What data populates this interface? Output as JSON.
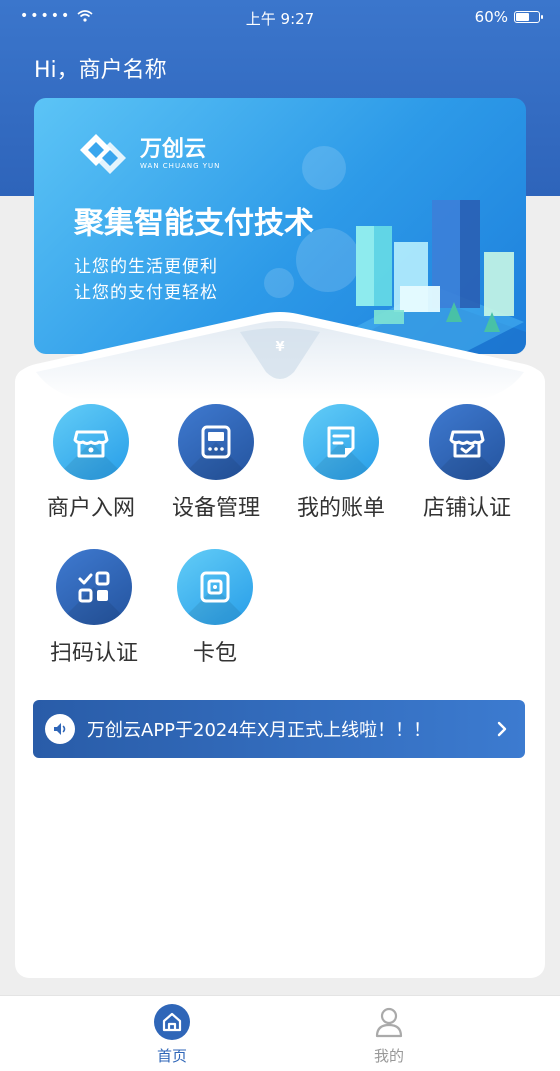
{
  "status_bar": {
    "time": "上午 9:27",
    "battery": "60%",
    "battery_level": 0.6
  },
  "header": {
    "greeting": "Hi，商户名称"
  },
  "banner": {
    "logo_cn": "万创云",
    "logo_en": "WAN CHUANG YUN",
    "title": "聚集智能支付技术",
    "subtitle_1": "让您的生活更便利",
    "subtitle_2": "让您的支付更轻松",
    "currency_symbol": "¥"
  },
  "menu": [
    {
      "label": "商户入网",
      "icon": "store-icon"
    },
    {
      "label": "设备管理",
      "icon": "pos-device-icon"
    },
    {
      "label": "我的账单",
      "icon": "bill-icon"
    },
    {
      "label": "店铺认证",
      "icon": "store-verify-icon"
    },
    {
      "label": "扫码认证",
      "icon": "qr-scan-icon"
    },
    {
      "label": "卡包",
      "icon": "card-wallet-icon"
    }
  ],
  "notice": {
    "text": "万创云APP于2024年X月正式上线啦！！！",
    "icon": "speaker-icon"
  },
  "tabbar": [
    {
      "label": "首页",
      "icon": "home-icon",
      "active": true
    },
    {
      "label": "我的",
      "icon": "user-icon",
      "active": false
    }
  ],
  "colors": {
    "primary": "#2f66b8",
    "accent_light": "#3fb3f0",
    "tab_inactive": "#999999"
  }
}
